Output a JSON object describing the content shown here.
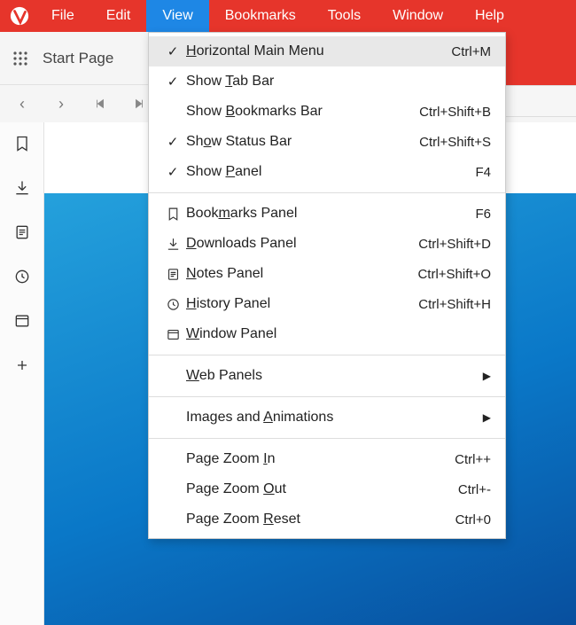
{
  "menubar": {
    "items": [
      "File",
      "Edit",
      "View",
      "Bookmarks",
      "Tools",
      "Window",
      "Help"
    ],
    "active": "View"
  },
  "tabstrip": {
    "tab_title": "Start Page"
  },
  "view_menu": {
    "items": [
      {
        "type": "check",
        "checked": true,
        "label": "Horizontal Main Menu",
        "underline": 0,
        "shortcut": "Ctrl+M",
        "highlight": true
      },
      {
        "type": "check",
        "checked": true,
        "label": "Show Tab Bar",
        "underline": 5,
        "shortcut": ""
      },
      {
        "type": "check",
        "checked": false,
        "label": "Show Bookmarks Bar",
        "underline": 5,
        "shortcut": "Ctrl+Shift+B"
      },
      {
        "type": "check",
        "checked": true,
        "label": "Show Status Bar",
        "underline": 2,
        "shortcut": "Ctrl+Shift+S"
      },
      {
        "type": "check",
        "checked": true,
        "label": "Show Panel",
        "underline": 5,
        "shortcut": "F4"
      },
      {
        "type": "sep"
      },
      {
        "type": "icon",
        "icon": "bookmark-icon",
        "label": "Bookmarks Panel",
        "underline": 4,
        "shortcut": "F6"
      },
      {
        "type": "icon",
        "icon": "download-icon",
        "label": "Downloads Panel",
        "underline": 0,
        "shortcut": "Ctrl+Shift+D"
      },
      {
        "type": "icon",
        "icon": "notes-icon",
        "label": "Notes Panel",
        "underline": 0,
        "shortcut": "Ctrl+Shift+O"
      },
      {
        "type": "icon",
        "icon": "history-icon",
        "label": "History Panel",
        "underline": 0,
        "shortcut": "Ctrl+Shift+H"
      },
      {
        "type": "icon",
        "icon": "window-icon",
        "label": "Window Panel",
        "underline": 0,
        "shortcut": ""
      },
      {
        "type": "sep"
      },
      {
        "type": "sub",
        "label": "Web Panels",
        "underline": 0
      },
      {
        "type": "sep"
      },
      {
        "type": "sub",
        "label": "Images and Animations",
        "underline": 11
      },
      {
        "type": "sep"
      },
      {
        "type": "plain",
        "label": "Page Zoom In",
        "underline": 10,
        "shortcut": "Ctrl++"
      },
      {
        "type": "plain",
        "label": "Page Zoom Out",
        "underline": 10,
        "shortcut": "Ctrl+-"
      },
      {
        "type": "plain",
        "label": "Page Zoom Reset",
        "underline": 10,
        "shortcut": "Ctrl+0"
      }
    ]
  }
}
